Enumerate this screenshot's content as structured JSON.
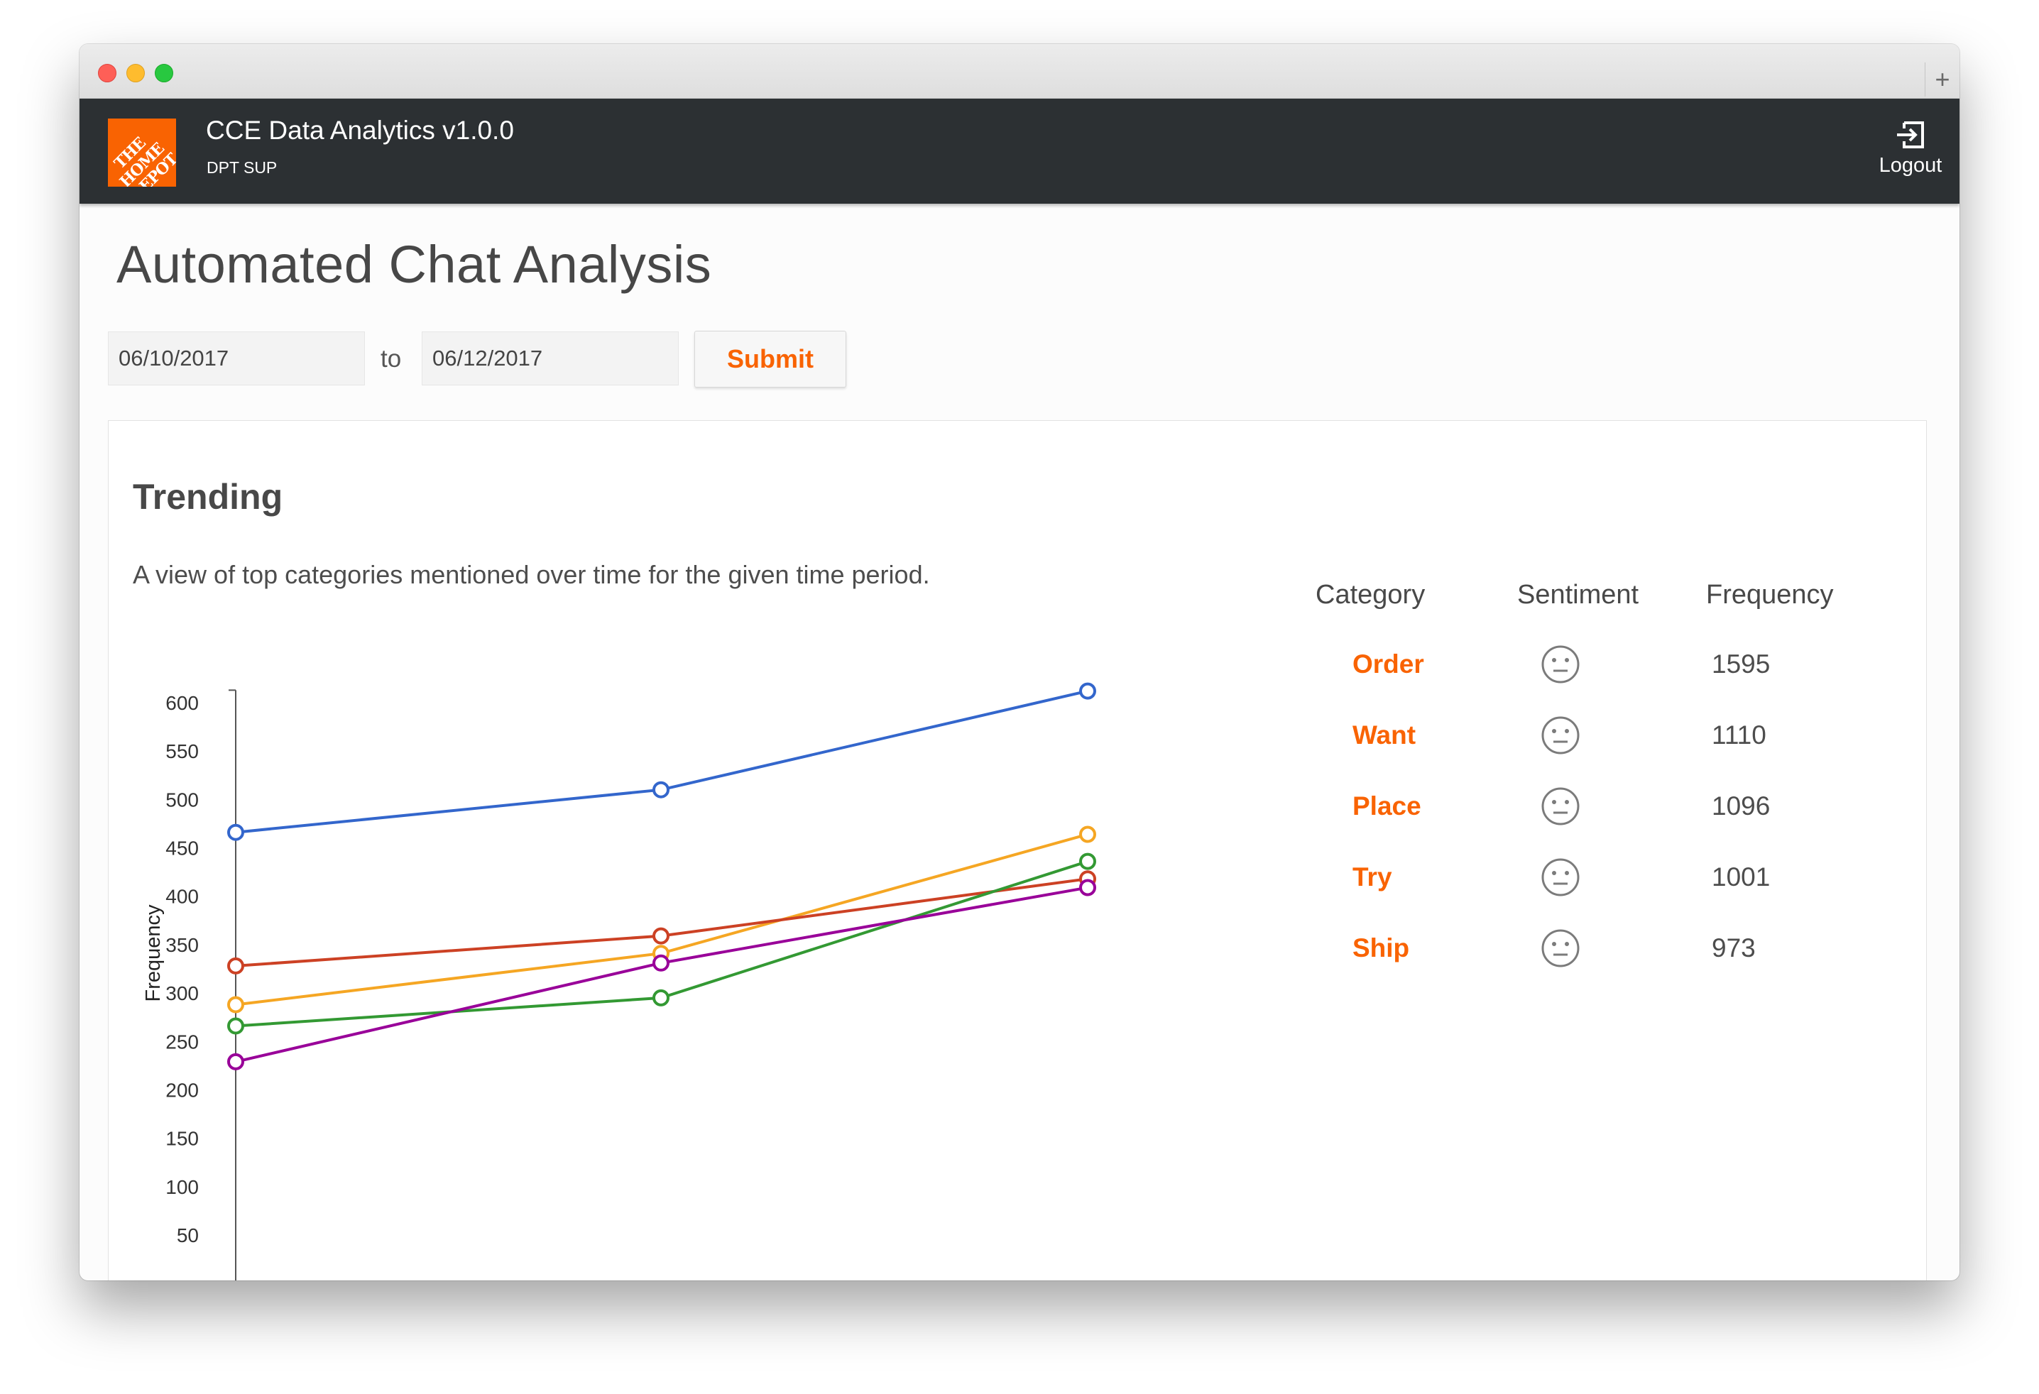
{
  "window": {
    "new_tab_glyph": "+"
  },
  "app": {
    "logo_text": "THE HOME DEPOT",
    "title": "CCE Data Analytics v1.0.0",
    "subtitle": "DPT SUP",
    "logout_label": "Logout",
    "brand_color": "#f96302",
    "bar_color": "#2c3033"
  },
  "page": {
    "title": "Automated Chat Analysis",
    "date_start": "06/10/2017",
    "to_label": "to",
    "date_end": "06/12/2017",
    "submit_label": "Submit"
  },
  "trending": {
    "title": "Trending",
    "description": "A view of top categories mentioned over time for the given time period.",
    "table": {
      "headers": [
        "Category",
        "Sentiment",
        "Frequency"
      ],
      "rows": [
        {
          "category": "Order",
          "sentiment": "neutral-face-icon",
          "frequency": "1595"
        },
        {
          "category": "Want",
          "sentiment": "neutral-face-icon",
          "frequency": "1110"
        },
        {
          "category": "Place",
          "sentiment": "neutral-face-icon",
          "frequency": "1096"
        },
        {
          "category": "Try",
          "sentiment": "neutral-face-icon",
          "frequency": "1001"
        },
        {
          "category": "Ship",
          "sentiment": "neutral-face-icon",
          "frequency": "973"
        }
      ]
    }
  },
  "chart_data": {
    "type": "line",
    "ylabel": "Frequency",
    "ylim": [
      0,
      610
    ],
    "yticks": [
      50,
      100,
      150,
      200,
      250,
      300,
      350,
      400,
      450,
      500,
      550,
      600
    ],
    "x": [
      1,
      2,
      3
    ],
    "series": [
      {
        "color": "#3366cc",
        "values": [
          466,
          510,
          612
        ]
      },
      {
        "color": "#f5a623",
        "values": [
          288,
          341,
          464
        ]
      },
      {
        "color": "#cc4124",
        "values": [
          328,
          359,
          418
        ]
      },
      {
        "color": "#339933",
        "values": [
          266,
          295,
          436
        ]
      },
      {
        "color": "#990099",
        "values": [
          229,
          331,
          409
        ]
      }
    ]
  }
}
